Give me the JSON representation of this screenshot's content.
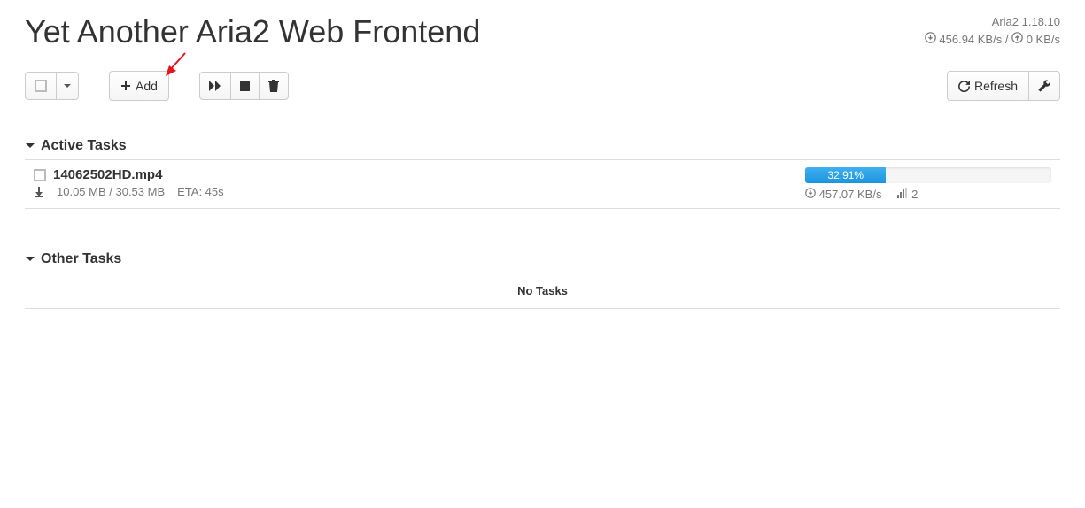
{
  "header": {
    "title": "Yet Another Aria2 Web Frontend",
    "version": "Aria2 1.18.10",
    "down_speed": "456.94 KB/s",
    "up_speed": "0 KB/s"
  },
  "toolbar": {
    "add_label": "Add",
    "refresh_label": "Refresh"
  },
  "sections": {
    "active_title": "Active Tasks",
    "other_title": "Other Tasks",
    "no_tasks_label": "No Tasks"
  },
  "active_tasks": [
    {
      "name": "14062502HD.mp4",
      "size_progress": "10.05 MB / 30.53 MB",
      "eta": "ETA: 45s",
      "percent": "32.91%",
      "speed": "457.07 KB/s",
      "connections": "2"
    }
  ]
}
